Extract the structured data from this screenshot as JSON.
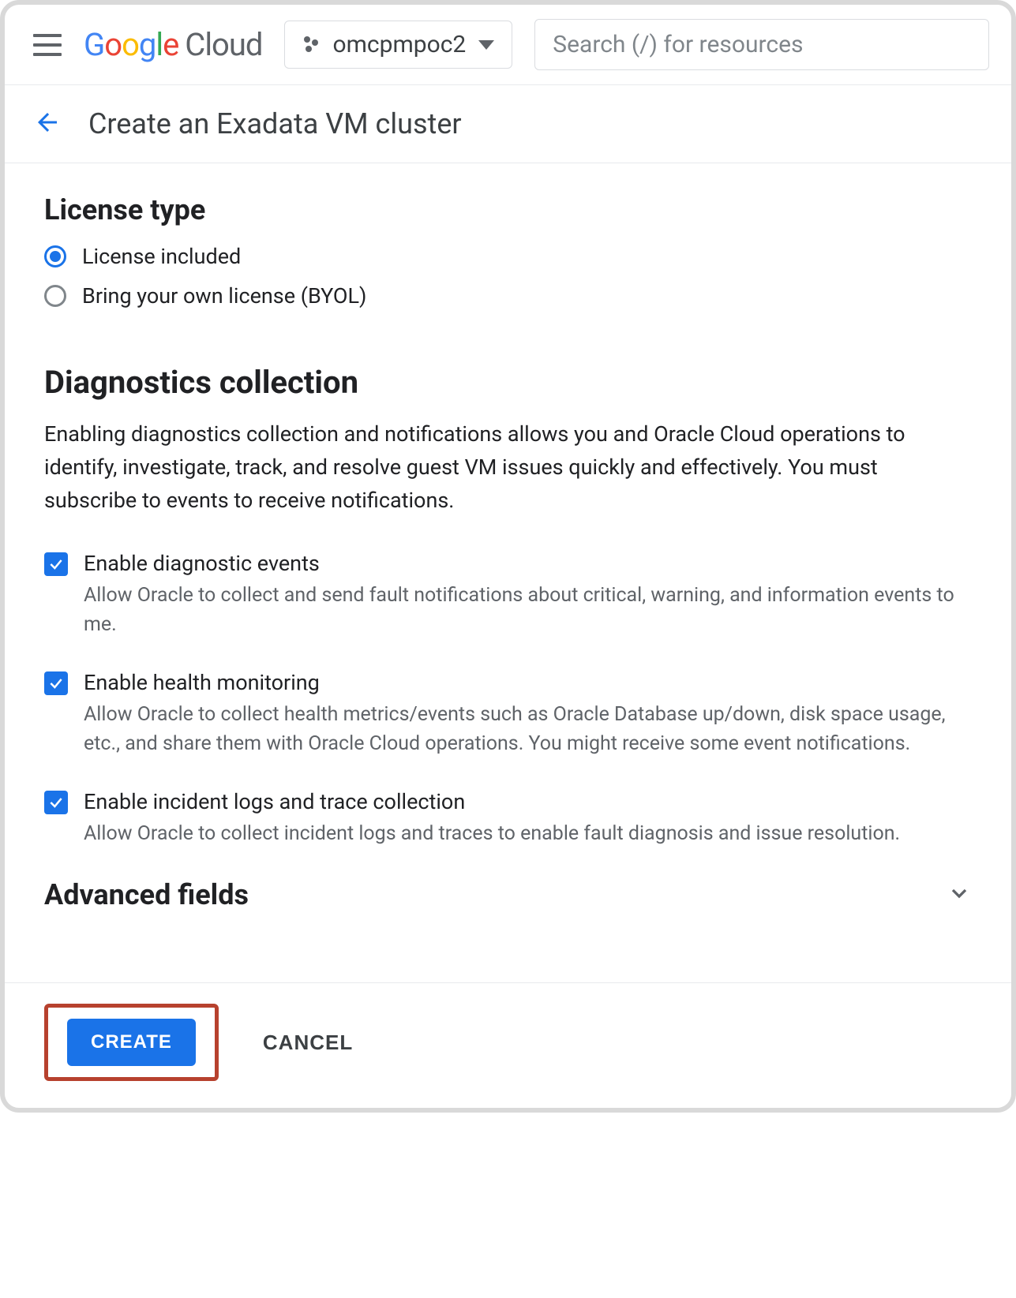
{
  "header": {
    "logo_product": "Cloud",
    "project_name": "omcpmpoc2",
    "search_placeholder": "Search (/) for resources"
  },
  "page": {
    "title": "Create an Exadata VM cluster"
  },
  "license": {
    "heading": "License type",
    "options": {
      "included": {
        "label": "License included",
        "checked": true
      },
      "byol": {
        "label": "Bring your own license (BYOL)",
        "checked": false
      }
    }
  },
  "diagnostics": {
    "heading": "Diagnostics collection",
    "description": "Enabling diagnostics collection and notifications allows you and Oracle Cloud operations to identify, investigate, track, and resolve guest VM issues quickly and effectively. You must subscribe to events to receive notifications.",
    "items": [
      {
        "label": "Enable diagnostic events",
        "sub": "Allow Oracle to collect and send fault notifications about critical, warning, and information events to me.",
        "checked": true
      },
      {
        "label": "Enable health monitoring",
        "sub": "Allow Oracle to collect health metrics/events such as Oracle Database up/down, disk space usage, etc., and share them with Oracle Cloud operations. You might receive some event notifications.",
        "checked": true
      },
      {
        "label": "Enable incident logs and trace collection",
        "sub": "Allow Oracle to collect incident logs and traces to enable fault diagnosis and issue resolution.",
        "checked": true
      }
    ]
  },
  "advanced": {
    "heading": "Advanced fields",
    "expanded": false
  },
  "footer": {
    "create": "CREATE",
    "cancel": "CANCEL"
  }
}
